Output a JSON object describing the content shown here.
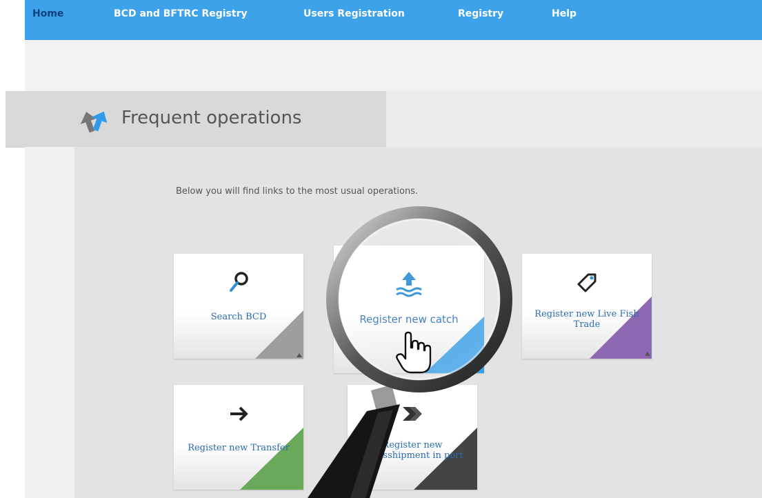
{
  "nav": {
    "items": [
      {
        "label": "Home"
      },
      {
        "label": "BCD and BFTRC Registry"
      },
      {
        "label": "Users Registration"
      },
      {
        "label": "Registry"
      },
      {
        "label": "Help"
      }
    ]
  },
  "header": {
    "title": "Frequent operations",
    "icon": "arrows-swap-icon"
  },
  "intro": {
    "text": "Below you will find links to the most usual operations."
  },
  "cards": [
    {
      "label": "Search BCD",
      "icon": "magnifier-icon",
      "accent": "#9e9e9e"
    },
    {
      "label": "Register new catch",
      "icon": "catch-wave-icon",
      "accent": "#3a9ee4"
    },
    {
      "label": "Register new Live Fish Trade",
      "icon": "tag-icon",
      "accent": "#8e67b2"
    },
    {
      "label": "Register new Transfer",
      "icon": "arrow-right-icon",
      "accent": "#6aa95a"
    },
    {
      "label": "Register new Transshipment in port",
      "icon": "double-arrow-icon",
      "accent": "#444444"
    }
  ],
  "colors": {
    "nav_bg": "#3ea2ea",
    "link": "#2b6cb0"
  }
}
